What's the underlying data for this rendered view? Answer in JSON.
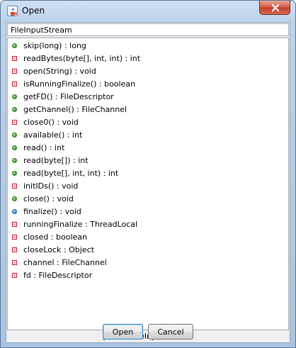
{
  "window": {
    "title": "Open",
    "icon": "java-cup-icon",
    "close_icon": "close-icon"
  },
  "search": {
    "value": "FileInputStream",
    "placeholder": ""
  },
  "members": [
    {
      "label": "skip(long) : long",
      "visibility": "public"
    },
    {
      "label": "readBytes(byte[], int, int) : int",
      "visibility": "private"
    },
    {
      "label": "open(String) : void",
      "visibility": "private"
    },
    {
      "label": "isRunningFinalize() : boolean",
      "visibility": "private"
    },
    {
      "label": "getFD() : FileDescriptor",
      "visibility": "public"
    },
    {
      "label": "getChannel() : FileChannel",
      "visibility": "public"
    },
    {
      "label": "close0() : void",
      "visibility": "private"
    },
    {
      "label": "available() : int",
      "visibility": "public"
    },
    {
      "label": "read() : int",
      "visibility": "public"
    },
    {
      "label": "read(byte[]) : int",
      "visibility": "public"
    },
    {
      "label": "read(byte[], int, int) : int",
      "visibility": "public"
    },
    {
      "label": "initIDs() : void",
      "visibility": "private"
    },
    {
      "label": "close() : void",
      "visibility": "public"
    },
    {
      "label": "finalize() : void",
      "visibility": "protected"
    },
    {
      "label": "runningFinalize : ThreadLocal",
      "visibility": "private"
    },
    {
      "label": "closed : boolean",
      "visibility": "private"
    },
    {
      "label": "closeLock : Object",
      "visibility": "private"
    },
    {
      "label": "channel : FileChannel",
      "visibility": "private"
    },
    {
      "label": "fd : FileDescriptor",
      "visibility": "private"
    }
  ],
  "status": "java.io.FileInputStream",
  "buttons": {
    "open_label": "Open",
    "cancel_label": "Cancel"
  },
  "colors": {
    "public": "#3c9a2a",
    "private": "#c0162a",
    "protected": "#2f7fd0",
    "close_button": "#c2402a"
  }
}
